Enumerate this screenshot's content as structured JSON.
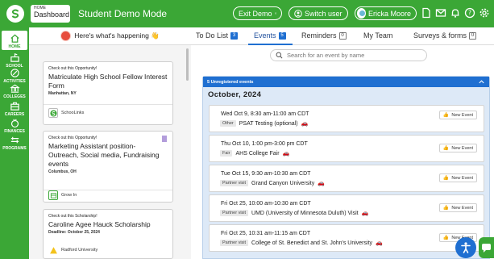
{
  "header": {
    "dashboard_small": "HOME",
    "dashboard_label": "Dashboard",
    "mode_title": "Student Demo Mode",
    "exit_demo": "Exit Demo",
    "switch_user": "Switch user",
    "user_name": "Ericka Moore",
    "brand_color": "#3ba736"
  },
  "nav": {
    "items": [
      {
        "label": "HOME",
        "icon": "home-icon"
      },
      {
        "label": "SCHOOL",
        "icon": "school-icon"
      },
      {
        "label": "ACTIVITIES",
        "icon": "activities-icon"
      },
      {
        "label": "COLLEGES",
        "icon": "colleges-icon"
      },
      {
        "label": "CAREERS",
        "icon": "careers-icon"
      },
      {
        "label": "FINANCES",
        "icon": "finances-icon"
      },
      {
        "label": "PROGRAMS",
        "icon": "programs-icon"
      }
    ]
  },
  "feed": {
    "heading": "Here's what's happening 👋",
    "cards": [
      {
        "kicker": "Check out this Opportunity!",
        "title": "Matriculate High School Fellow Interest Form",
        "meta": "Manhattan, NY",
        "source": "SchooLinks"
      },
      {
        "kicker": "Check out this Opportunity!",
        "title": "Marketing Assistant position- Outreach, Social media, Fundraising events",
        "meta": "Columbus, OH",
        "source": "Grow In"
      },
      {
        "kicker": "Check out this Scholarship!",
        "title": "Caroline Agee Hauck Scholarship",
        "meta": "Deadline: October 25, 2024",
        "source": "Radford University"
      }
    ]
  },
  "tabs": [
    {
      "label": "To Do List",
      "count": "3"
    },
    {
      "label": "Events",
      "count": "5"
    },
    {
      "label": "Reminders",
      "count": "0"
    },
    {
      "label": "My Team",
      "count": ""
    },
    {
      "label": "Surveys & forms",
      "count": "0"
    }
  ],
  "search": {
    "placeholder": "Search for an event by name"
  },
  "events": {
    "header": "5 Unregistered events",
    "month": "October, 2024",
    "new_event_label": "New Event",
    "items": [
      {
        "when": "Wed Oct 9, 8:30 am-11:00 am CDT",
        "type": "Other",
        "name": "PSAT Testing (optional)"
      },
      {
        "when": "Thu Oct 10, 1:00 pm-3:00 pm CDT",
        "type": "Fair",
        "name": "AHS College Fair"
      },
      {
        "when": "Tue Oct 15, 9:30 am-10:30 am CDT",
        "type": "Partner visit",
        "name": "Grand Canyon University"
      },
      {
        "when": "Fri Oct 25, 10:00 am-10:30 am CDT",
        "type": "Partner visit",
        "name": "UMD (University of Minnesota Duluth) Visit"
      },
      {
        "when": "Fri Oct 25, 10:31 am-11:15 am CDT",
        "type": "Partner visit",
        "name": "College of St. Benedict and St. John's University"
      }
    ]
  }
}
